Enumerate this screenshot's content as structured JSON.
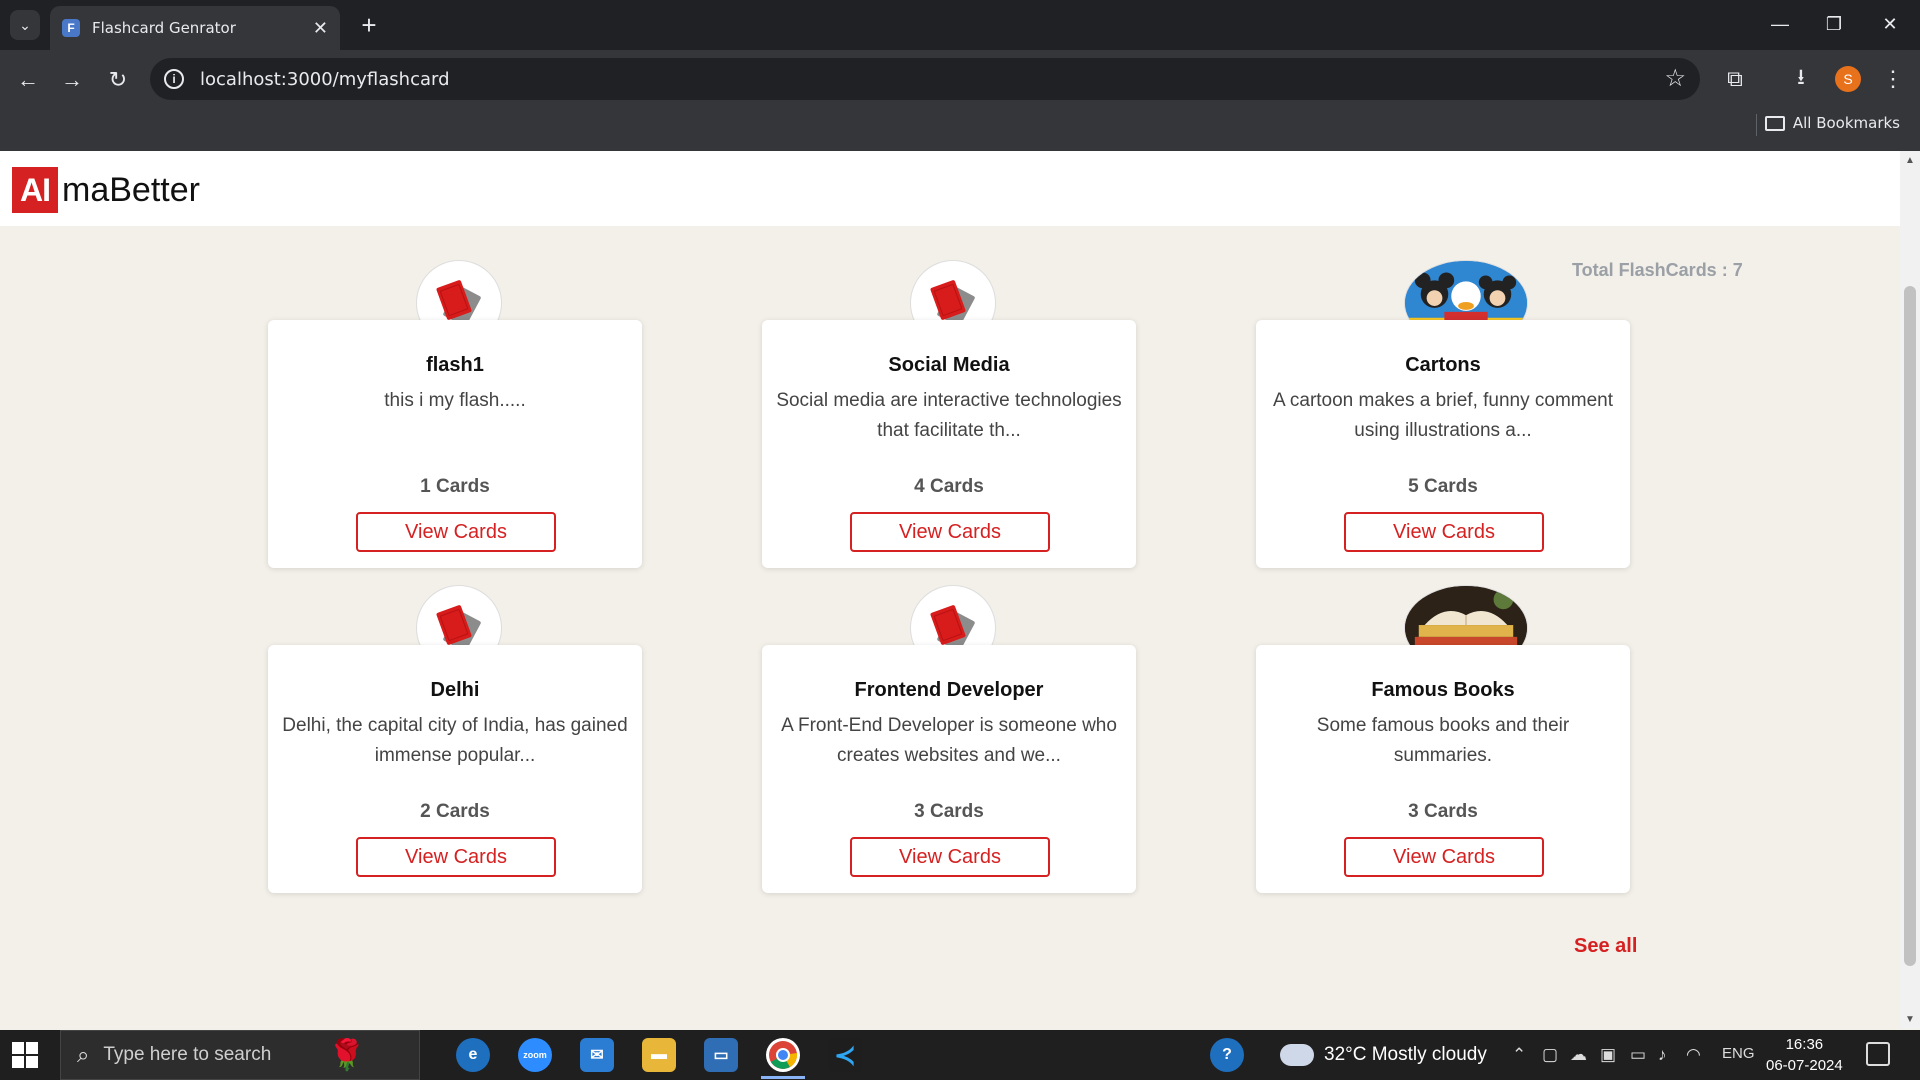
{
  "browser": {
    "tab_title": "Flashcard Genrator",
    "url": "localhost:3000/myflashcard",
    "bookmarks_label": "All Bookmarks",
    "profile_initial": "S"
  },
  "app": {
    "logo_ai": "AI",
    "logo_rest": "maBetter",
    "total_label": "Total FlashCards : 7",
    "see_all": "See all",
    "view_label": "View Cards",
    "accent_color": "#d52121"
  },
  "cards": [
    {
      "title": "flash1",
      "description": "this i my flash.....",
      "count": "1 Cards",
      "image": "flashcard-icon"
    },
    {
      "title": "Social Media",
      "description": "Social media are interactive technologies that facilitate th...",
      "count": "4 Cards",
      "image": "flashcard-icon"
    },
    {
      "title": "Cartons",
      "description": "A cartoon makes a brief, funny comment using illustrations a...",
      "count": "5 Cards",
      "image": "cartoon-image"
    },
    {
      "title": "Delhi",
      "description": "Delhi, the capital city of India, has gained immense popular...",
      "count": "2 Cards",
      "image": "flashcard-icon"
    },
    {
      "title": "Frontend Developer",
      "description": "A Front-End Developer is someone who creates websites and we...",
      "count": "3 Cards",
      "image": "flashcard-icon"
    },
    {
      "title": "Famous Books",
      "description": "Some famous books and their summaries.",
      "count": "3 Cards",
      "image": "books-image"
    }
  ],
  "taskbar": {
    "search_placeholder": "Type here to search",
    "weather": "32°C  Mostly cloudy",
    "language": "ENG",
    "time": "16:36",
    "date": "06-07-2024"
  }
}
